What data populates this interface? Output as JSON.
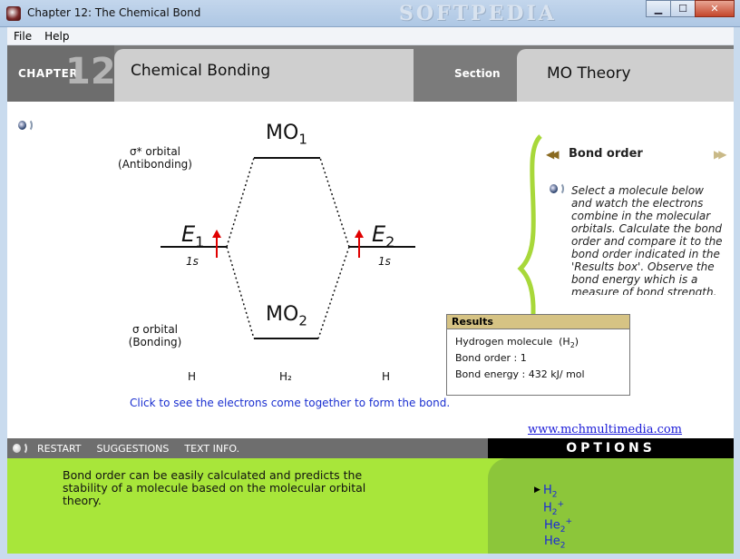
{
  "window": {
    "title": "Chapter 12: The Chemical Bond",
    "watermark": "SOFTPEDIA"
  },
  "menu": {
    "file": "File",
    "help": "Help"
  },
  "header": {
    "chapter_label": "CHAPTER",
    "chapter_number": "12",
    "topic": "Chemical Bonding",
    "section_label": "Section",
    "section_name": "MO Theory"
  },
  "diagram": {
    "mo1": "MO",
    "mo1_sub": "1",
    "mo2": "MO",
    "mo2_sub": "2",
    "antibonding_line1": "σ* orbital",
    "antibonding_line2": "(Antibonding)",
    "bonding_line1": "σ orbital",
    "bonding_line2": "(Bonding)",
    "e1": "E",
    "e1_sub": "1",
    "e2": "E",
    "e2_sub": "2",
    "orbital_left": "1s",
    "orbital_right": "1s",
    "atom_left": "H",
    "atom_middle": "H₂",
    "atom_right": "H",
    "hint": "Click to see the electrons come together to form the bond."
  },
  "panel": {
    "title": "Bond order",
    "description": "Select a molecule below and watch the electrons combine in the molecular orbitals. Calculate the bond order and compare it to the bond order indicated in the 'Results box'. Observe the bond energy which is a measure of bond strength."
  },
  "results": {
    "header": "Results",
    "molecule_label": "Hydrogen molecule",
    "molecule_formula_open": "(H",
    "molecule_formula_sub": "2",
    "molecule_formula_close": ")",
    "bond_order": "Bond order : 1",
    "bond_energy": "Bond energy : 432 kJ/ mol"
  },
  "site_link": "www.mchmultimedia.com",
  "toolbar": {
    "restart": "RESTART",
    "suggestions": "SUGGESTIONS",
    "text_info": "TEXT INFO.",
    "options": "OPTIONS"
  },
  "summary": "Bond order can be easily calculated and predicts the stability of a molecule based on the molecular orbital theory.",
  "options": [
    {
      "base": "H",
      "sub": "2",
      "sup": ""
    },
    {
      "base": "H",
      "sub": "2",
      "sup": "+"
    },
    {
      "base": "He",
      "sub": "2",
      "sup": "+"
    },
    {
      "base": "He",
      "sub": "2",
      "sup": ""
    }
  ],
  "colors": {
    "header_gray": "#7b7b7b",
    "tab_gray": "#cfcfcf",
    "accent_green": "#a8e63a",
    "link_blue": "#1a28d8",
    "electron_red": "#e00000"
  }
}
